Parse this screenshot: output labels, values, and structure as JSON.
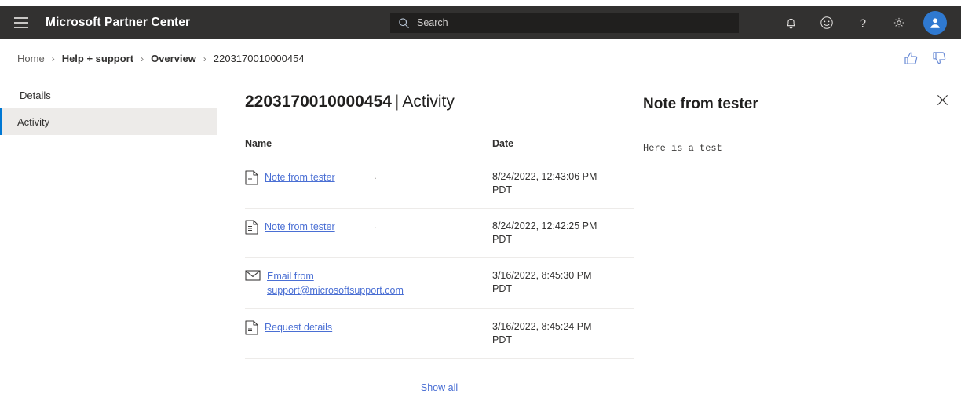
{
  "header": {
    "menu_icon": "hamburger-icon",
    "brand": "Microsoft Partner Center",
    "search": {
      "placeholder": "Search",
      "value": "",
      "icon": "search-icon"
    },
    "actions": [
      {
        "name": "notifications-icon",
        "glyph": "bell"
      },
      {
        "name": "feedback-icon",
        "glyph": "smiley"
      },
      {
        "name": "help-icon",
        "glyph": "question"
      },
      {
        "name": "settings-icon",
        "glyph": "gear"
      },
      {
        "name": "account-avatar",
        "glyph": "person"
      }
    ],
    "colors": {
      "bar": "#323130",
      "search_bg": "#201f1e",
      "avatar": "#2f79d0"
    }
  },
  "breadcrumb": {
    "items": [
      {
        "label": "Home",
        "style": "muted"
      },
      {
        "label": "Help + support",
        "style": "strong"
      },
      {
        "label": "Overview",
        "style": "strong"
      },
      {
        "label": "2203170010000454",
        "style": "plain"
      }
    ],
    "separator": "›",
    "feedback": [
      {
        "name": "thumbs-up-icon",
        "label": "Thumbs up"
      },
      {
        "name": "thumbs-down-icon",
        "label": "Thumbs down"
      }
    ]
  },
  "sidebar": {
    "items": [
      {
        "label": "Details",
        "selected": false
      },
      {
        "label": "Activity",
        "selected": true
      }
    ],
    "accent": "#0078d4",
    "selected_bg": "#edebe9"
  },
  "main": {
    "title_id": "2203170010000454",
    "title_separator": "|",
    "title_page": "Activity",
    "table": {
      "columns": [
        "Name",
        "Date"
      ],
      "rows": [
        {
          "icon": "document-icon",
          "name": "Note from tester",
          "trailing_mark": ".",
          "date": "8/24/2022, 12:43:06 PM\nPDT"
        },
        {
          "icon": "document-icon",
          "name": "Note from tester",
          "trailing_mark": ".",
          "date": "8/24/2022, 12:42:25 PM\nPDT"
        },
        {
          "icon": "email-icon",
          "name": "Email from support@microsoftsupport.com",
          "trailing_mark": "",
          "date": "3/16/2022, 8:45:30 PM\nPDT"
        },
        {
          "icon": "document-icon",
          "name": "Request details",
          "trailing_mark": "",
          "date": "3/16/2022, 8:45:24 PM\nPDT"
        }
      ]
    },
    "show_all": "Show all",
    "link_color": "#4a6fd4"
  },
  "detail_pane": {
    "title": "Note from tester",
    "body": "Here is a test",
    "close_icon": "close-icon"
  }
}
